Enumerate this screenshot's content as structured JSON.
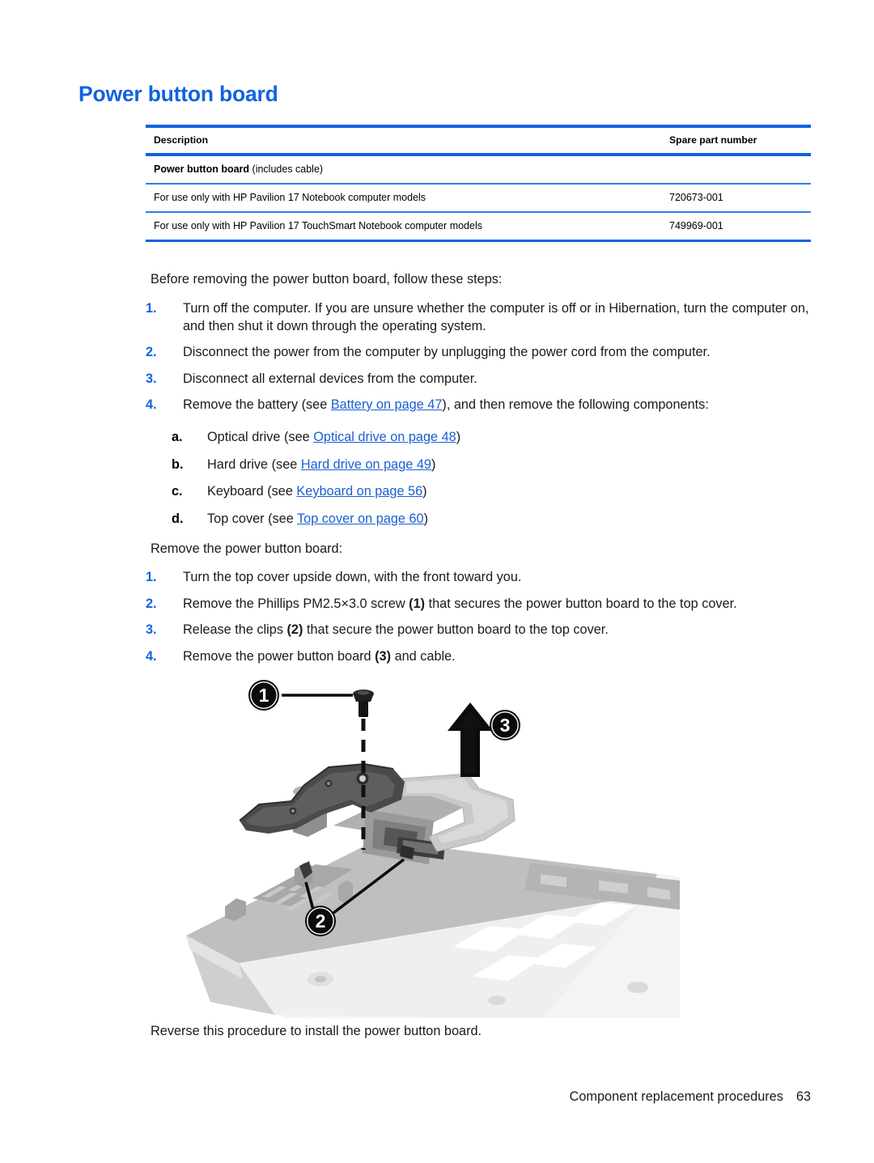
{
  "document": {
    "title": "Power button board",
    "title_color": "#1163e0"
  },
  "parts_table": {
    "columns": [
      "Description",
      "Spare part number"
    ],
    "group_row": {
      "bold_text": "Power button board",
      "rest_text": " (includes cable)"
    },
    "rows": [
      {
        "description": "For use only with HP Pavilion 17 Notebook computer models",
        "spare_part_number": "720673-001"
      },
      {
        "description": "For use only with HP Pavilion 17 TouchSmart Notebook computer models",
        "spare_part_number": "749969-001"
      }
    ],
    "rule_color": "#1163e0"
  },
  "intro": "Before removing the power button board, follow these steps:",
  "prereq_steps": [
    {
      "marker": "1.",
      "text_before": "Turn off the computer. If you are unsure whether the computer is off or in Hibernation, turn the computer on, and then shut it down through the operating system.",
      "link": null,
      "text_after": ""
    },
    {
      "marker": "2.",
      "text_before": "Disconnect the power from the computer by unplugging the power cord from the computer.",
      "link": null,
      "text_after": ""
    },
    {
      "marker": "3.",
      "text_before": "Disconnect all external devices from the computer.",
      "link": null,
      "text_after": ""
    },
    {
      "marker": "4.",
      "text_before": "Remove the battery (see ",
      "link": "Battery on page 47",
      "text_after": "), and then remove the following components:"
    }
  ],
  "prereq_substeps": [
    {
      "marker": "a.",
      "text_before": "Optical drive (see ",
      "link": "Optical drive on page 48",
      "text_after": ")"
    },
    {
      "marker": "b.",
      "text_before": "Hard drive (see ",
      "link": "Hard drive on page 49",
      "text_after": ")"
    },
    {
      "marker": "c.",
      "text_before": "Keyboard (see ",
      "link": "Keyboard on page 56",
      "text_after": ")"
    },
    {
      "marker": "d.",
      "text_before": "Top cover (see ",
      "link": "Top cover on page 60",
      "text_after": ")"
    }
  ],
  "mid_heading": "Remove the power button board:",
  "removal_steps": [
    {
      "marker": "1.",
      "parts": [
        {
          "type": "text",
          "value": "Turn the top cover upside down, with the front toward you."
        }
      ]
    },
    {
      "marker": "2.",
      "parts": [
        {
          "type": "text",
          "value": "Remove the Phillips PM2.5×3.0 screw "
        },
        {
          "type": "bold",
          "value": "(1)"
        },
        {
          "type": "text",
          "value": " that secures the power button board to the top cover."
        }
      ]
    },
    {
      "marker": "3.",
      "parts": [
        {
          "type": "text",
          "value": "Release the clips "
        },
        {
          "type": "bold",
          "value": "(2)"
        },
        {
          "type": "text",
          "value": " that secure the power button board to the top cover."
        }
      ]
    },
    {
      "marker": "4.",
      "parts": [
        {
          "type": "text",
          "value": "Remove the power button board "
        },
        {
          "type": "bold",
          "value": "(3)"
        },
        {
          "type": "text",
          "value": " and cable."
        }
      ]
    }
  ],
  "figure": {
    "alt": "Exploded view of power button board removal from top cover",
    "callouts": [
      {
        "id": "1",
        "label": "1",
        "meaning": "Phillips PM2.5×3.0 screw"
      },
      {
        "id": "2",
        "label": "2",
        "meaning": "clips securing the power button board"
      },
      {
        "id": "3",
        "label": "3",
        "meaning": "power button board lift direction"
      }
    ]
  },
  "outro": "Reverse this procedure to install the power button board.",
  "footer": {
    "section": "Component replacement procedures",
    "page_number": "63"
  }
}
